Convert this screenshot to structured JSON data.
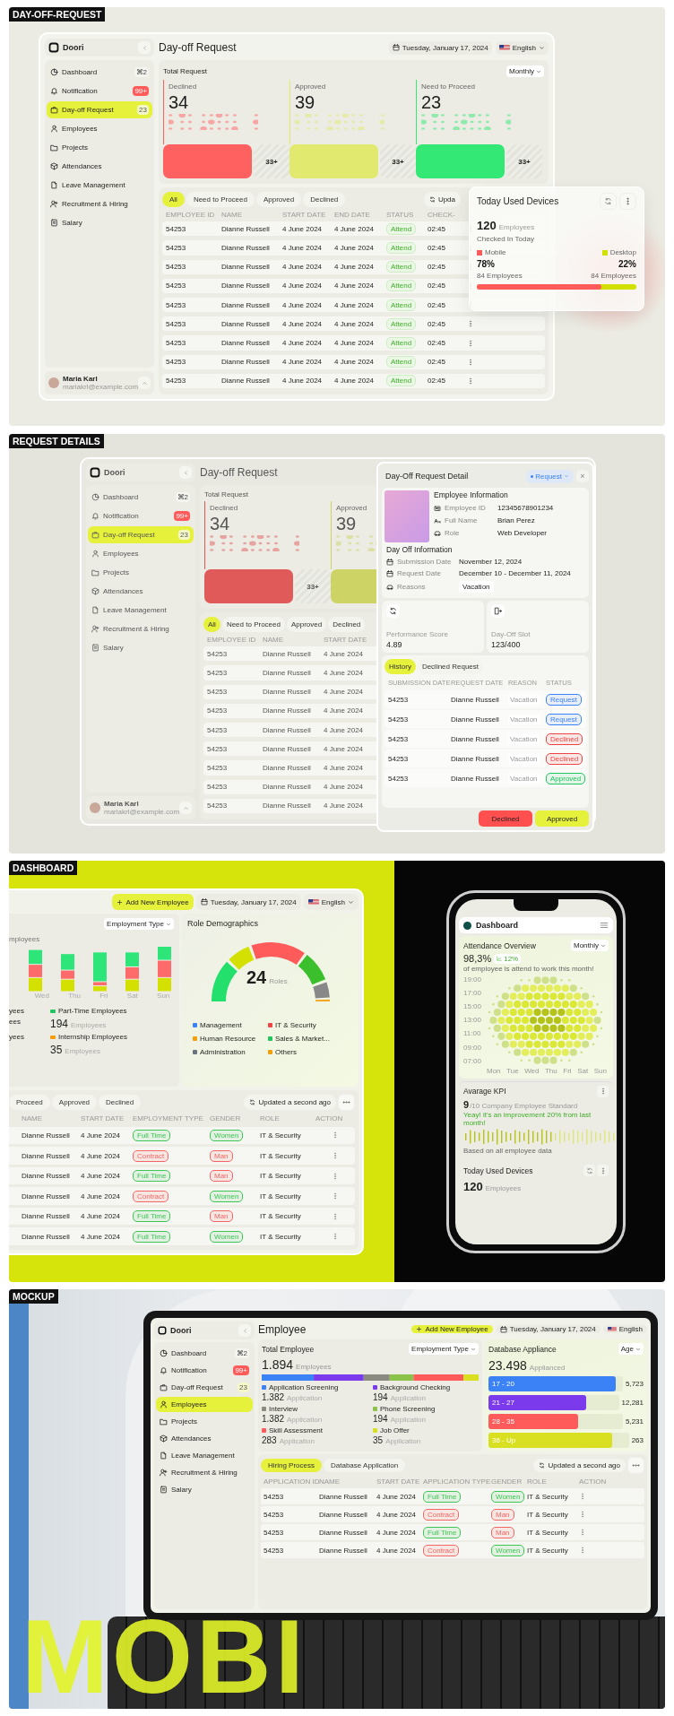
{
  "day_off_request": {
    "label": "DAY-OFF-REQUEST",
    "app": {
      "brand": "Doori",
      "nav": [
        {
          "label": "Dashboard",
          "kind": "dashboard",
          "badge": {
            "text": "⌘2",
            "kind": "shortcut"
          },
          "selected": false
        },
        {
          "label": "Notification",
          "kind": "notification",
          "badge": {
            "text": "99+",
            "kind": "alert"
          },
          "selected": false
        },
        {
          "label": "Day-off Request",
          "kind": "dayoff",
          "badge": {
            "text": "23",
            "kind": "count"
          },
          "selected": true
        },
        {
          "label": "Employees",
          "kind": "employees",
          "selected": false
        },
        {
          "label": "Projects",
          "kind": "projects",
          "selected": false
        },
        {
          "label": "Attendances",
          "kind": "attendances",
          "selected": false
        },
        {
          "label": "Leave Management",
          "kind": "leave",
          "selected": false
        },
        {
          "label": "Recruitment & Hiring",
          "kind": "recruitment",
          "selected": false
        },
        {
          "label": "Salary",
          "kind": "salary",
          "selected": false
        }
      ],
      "user": {
        "name": "Maria Karl",
        "email": "mariakrl@example.com"
      },
      "title": "Day-off Request",
      "date": "Tuesday, January 17, 2024",
      "language": "English",
      "stats": {
        "title": "Total Request",
        "period": "Monthly",
        "cards": [
          {
            "label": "Declined",
            "value": "34",
            "more": "33+",
            "color": "#ff6161"
          },
          {
            "label": "Approved",
            "value": "39",
            "more": "33+",
            "color": "#e2e96f"
          },
          {
            "label": "Need to Proceed",
            "value": "23",
            "more": "33+",
            "color": "#33e874"
          }
        ]
      },
      "filters": [
        {
          "label": "All",
          "selected": true
        },
        {
          "label": "Need to Proceed",
          "selected": false
        },
        {
          "label": "Approved",
          "selected": false
        },
        {
          "label": "Declined",
          "selected": false
        }
      ],
      "update": "Upda",
      "columns": [
        "EMPLOYEE ID",
        "NAME",
        "START DATE",
        "END DATE",
        "STATUS",
        "CHECK-"
      ],
      "rows": [
        {
          "cells": [
            "54253",
            "Dianne Russell",
            "4 June 2024",
            "4 June 2024"
          ],
          "status": "Attend",
          "time": "02:45"
        },
        {
          "cells": [
            "54253",
            "Dianne Russell",
            "4 June 2024",
            "4 June 2024"
          ],
          "status": "Attend",
          "time": "02:45"
        },
        {
          "cells": [
            "54253",
            "Dianne Russell",
            "4 June 2024",
            "4 June 2024"
          ],
          "status": "Attend",
          "time": "02:45"
        },
        {
          "cells": [
            "54253",
            "Dianne Russell",
            "4 June 2024",
            "4 June 2024"
          ],
          "status": "Attend",
          "time": "02:45"
        },
        {
          "cells": [
            "54253",
            "Dianne Russell",
            "4 June 2024",
            "4 June 2024"
          ],
          "status": "Attend",
          "time": "02:45"
        },
        {
          "cells": [
            "54253",
            "Dianne Russell",
            "4 June 2024",
            "4 June 2024"
          ],
          "status": "Attend",
          "time": "02:45"
        },
        {
          "cells": [
            "54253",
            "Dianne Russell",
            "4 June 2024",
            "4 June 2024"
          ],
          "status": "Attend",
          "time": "02:45"
        },
        {
          "cells": [
            "54253",
            "Dianne Russell",
            "4 June 2024",
            "4 June 2024"
          ],
          "status": "Attend",
          "time": "02:45"
        },
        {
          "cells": [
            "54253",
            "Dianne Russell",
            "4 June 2024",
            "4 June 2024"
          ],
          "status": "Attend",
          "time": "02:45"
        }
      ]
    },
    "devices_popup": {
      "title": "Today Used Devices",
      "count": "120",
      "unit": "Employees",
      "caption": "Checked In Today",
      "devices": [
        {
          "name": "Mobile",
          "color": "#ff5b5b",
          "percent": "78%",
          "employees": "84 Employees",
          "level": 0.78
        },
        {
          "name": "Desktop",
          "color": "#d2e000",
          "percent": "22%",
          "employees": "84 Employees"
        }
      ]
    }
  },
  "request_details": {
    "label": "REQUEST DETAILS",
    "background_app": {
      "brand": "Doori",
      "nav": [
        {
          "label": "Dashboard",
          "kind": "dashboard",
          "badge": {
            "text": "⌘2",
            "kind": "shortcut"
          },
          "selected": false
        },
        {
          "label": "Notification",
          "kind": "notification",
          "badge": {
            "text": "99+",
            "kind": "alert"
          },
          "selected": false
        },
        {
          "label": "Day-off Request",
          "kind": "dayoff",
          "badge": {
            "text": "23",
            "kind": "count"
          },
          "selected": true
        },
        {
          "label": "Employees",
          "kind": "employees",
          "selected": false
        },
        {
          "label": "Projects",
          "kind": "projects",
          "selected": false
        },
        {
          "label": "Attendances",
          "kind": "attendances",
          "selected": false
        },
        {
          "label": "Leave Management",
          "kind": "leave",
          "selected": false
        },
        {
          "label": "Recruitment & Hiring",
          "kind": "recruitment",
          "selected": false
        },
        {
          "label": "Salary",
          "kind": "salary",
          "selected": false
        }
      ],
      "user": {
        "name": "Maria Karl",
        "email": "mariakrl@example.com"
      },
      "title": "Day-off Request",
      "stats": {
        "title": "Total Request",
        "cards": [
          {
            "label": "Declined",
            "value": "34",
            "more": "33+",
            "color": "#e05a5a"
          },
          {
            "label": "Approved",
            "value": "39",
            "color": "#cdd465"
          }
        ]
      },
      "filters": [
        {
          "label": "All",
          "selected": true
        },
        {
          "label": "Need to Proceed",
          "selected": false
        },
        {
          "label": "Approved",
          "selected": false
        },
        {
          "label": "Declined",
          "selected": false
        }
      ],
      "columns": [
        "EMPLOYEE ID",
        "NAME",
        "START DATE"
      ],
      "rows": [
        {
          "cells": [
            "54253",
            "Dianne Russell",
            "4 June 2024"
          ]
        },
        {
          "cells": [
            "54253",
            "Dianne Russell",
            "4 June 2024"
          ]
        },
        {
          "cells": [
            "54253",
            "Dianne Russell",
            "4 June 2024"
          ]
        },
        {
          "cells": [
            "54253",
            "Dianne Russell",
            "4 June 2024"
          ]
        },
        {
          "cells": [
            "54253",
            "Dianne Russell",
            "4 June 2024"
          ]
        },
        {
          "cells": [
            "54253",
            "Dianne Russell",
            "4 June 2024"
          ]
        },
        {
          "cells": [
            "54253",
            "Dianne Russell",
            "4 June 2024"
          ]
        },
        {
          "cells": [
            "54253",
            "Dianne Russell",
            "4 June 2024"
          ]
        },
        {
          "cells": [
            "54253",
            "Dianne Russell",
            "4 June 2024"
          ]
        }
      ]
    },
    "detail_panel": {
      "title": "Day-Off Request Detail",
      "status_chip": "Request",
      "close": "×",
      "employee": {
        "heading": "Employee Information",
        "fields": [
          {
            "kind": "id",
            "label": "Employee ID",
            "value": "12345678901234"
          },
          {
            "kind": "name",
            "label": "Full Name",
            "value": "Brian Perez"
          },
          {
            "kind": "role",
            "label": "Role",
            "value": "Web Developer"
          }
        ]
      },
      "day_off": {
        "heading": "Day Off Information",
        "fields": [
          {
            "kind": "date",
            "label": "Submission Date",
            "value": "November 12, 2024"
          },
          {
            "kind": "date",
            "label": "Request Date",
            "value": "December 10 - December 11, 2024"
          },
          {
            "kind": "reason",
            "label": "Reasons",
            "value": "Vacation"
          }
        ]
      },
      "metrics": [
        {
          "kind": "refresh",
          "label": "Performance Score",
          "value": "4.89"
        },
        {
          "kind": "exit",
          "label": "Day-Off Slot",
          "value": "123/400"
        }
      ],
      "tabs": [
        {
          "label": "History",
          "selected": true
        },
        {
          "label": "Declined Request",
          "selected": false
        }
      ],
      "columns": [
        "SUBMISSION DATE",
        "REQUEST DATE",
        "REASON",
        "STATUS"
      ],
      "rows": [
        {
          "submission": "54253",
          "request": "Dianne Russell",
          "reason": "Vacation",
          "status": "Request",
          "color": "#3b82f6"
        },
        {
          "submission": "54253",
          "request": "Dianne Russell",
          "reason": "Vacation",
          "status": "Request",
          "color": "#3b82f6"
        },
        {
          "submission": "54253",
          "request": "Dianne Russell",
          "reason": "Vacation",
          "status": "Declined",
          "color": "#ef4444"
        },
        {
          "submission": "54253",
          "request": "Dianne Russell",
          "reason": "Vacation",
          "status": "Declined",
          "color": "#ef4444"
        },
        {
          "submission": "54253",
          "request": "Dianne Russell",
          "reason": "Vacation",
          "status": "Approved",
          "color": "#22c55e"
        }
      ],
      "buttons": [
        {
          "label": "Declined",
          "kind": "reject"
        },
        {
          "label": "Approved",
          "kind": "approve"
        }
      ]
    }
  },
  "dashboard": {
    "label": "DASHBOARD",
    "desktop": {
      "add_button": "Add New Employee",
      "date": "Tuesday, January 17, 2024",
      "language": "English",
      "employment": {
        "filter": "Employment Type",
        "caption": "mployees",
        "days": [
          "Wed",
          "Thu",
          "Fri",
          "Sat",
          "Sun"
        ],
        "left_fragments": [
          "yees",
          "ees",
          "yees"
        ],
        "groups": [
          {
            "label": "Part-Time Employees",
            "color": "#22c55e",
            "value": "194",
            "unit": "Employees"
          },
          {
            "label": "Internship Employees",
            "color": "#f59e0b",
            "value": "35",
            "unit": "Employees"
          }
        ]
      },
      "roles": {
        "title": "Role Demographics",
        "value": "24",
        "unit": "Roles",
        "legend": [
          {
            "label": "Management",
            "color": "#3b82f6"
          },
          {
            "label": "IT & Security",
            "color": "#ef4444"
          },
          {
            "label": "Human Resource",
            "color": "#f59e0b"
          },
          {
            "label": "Sales & Market...",
            "color": "#22c55e"
          },
          {
            "label": "Administration",
            "color": "#6b7280"
          },
          {
            "label": "Others",
            "color": "#f59e0b"
          }
        ]
      },
      "filters": [
        {
          "label": "Proceed",
          "selected": false
        },
        {
          "label": "Approved",
          "selected": false
        },
        {
          "label": "Declined",
          "selected": false
        }
      ],
      "update": "Updated a second ago",
      "columns": [
        "NAME",
        "START DATE",
        "EMPLOYMENT TYPE",
        "GENDER",
        "ROLE",
        "ACTION"
      ],
      "rows": [
        {
          "name": "Dianne Russell",
          "start": "4 June 2024",
          "type": {
            "text": "Full Time",
            "color": "#3fc556"
          },
          "gender": {
            "text": "Women",
            "color": "#3fc556"
          },
          "role": "IT & Security"
        },
        {
          "name": "Dianne Russell",
          "start": "4 June 2024",
          "type": {
            "text": "Contract",
            "color": "#f26666"
          },
          "gender": {
            "text": "Man",
            "color": "#f26666"
          },
          "role": "IT & Security"
        },
        {
          "name": "Dianne Russell",
          "start": "4 June 2024",
          "type": {
            "text": "Full Time",
            "color": "#3fc556"
          },
          "gender": {
            "text": "Man",
            "color": "#f26666"
          },
          "role": "IT & Security"
        },
        {
          "name": "Dianne Russell",
          "start": "4 June 2024",
          "type": {
            "text": "Contract",
            "color": "#f26666"
          },
          "gender": {
            "text": "Women",
            "color": "#3fc556"
          },
          "role": "IT & Security"
        },
        {
          "name": "Dianne Russell",
          "start": "4 June 2024",
          "type": {
            "text": "Full Time",
            "color": "#3fc556"
          },
          "gender": {
            "text": "Man",
            "color": "#f26666"
          },
          "role": "IT & Security"
        },
        {
          "name": "Dianne Russell",
          "start": "4 June 2024",
          "type": {
            "text": "Full Time",
            "color": "#3fc556"
          },
          "gender": {
            "text": "Women",
            "color": "#3fc556"
          },
          "role": "IT & Security"
        }
      ]
    },
    "phone": {
      "title": "Dashboard",
      "attendance": {
        "title": "Attendance Overview",
        "period": "Monthly",
        "value": "98,3%",
        "change": "12%",
        "caption": "of employee is attend to work this month!",
        "hours": [
          "19:00",
          "17:00",
          "15:00",
          "13:00",
          "11:00",
          "09:00",
          "07:00"
        ],
        "days": [
          "Mon",
          "Tue",
          "Wed",
          "Thu",
          "Fri",
          "Sat",
          "Sun"
        ]
      },
      "kpi": {
        "title": "Avarage KPI",
        "score": "9",
        "scale": "/10 Company Employee Standard",
        "note": "Yeay! it's an improvement 20% from last month!",
        "footer": "Based on all employee data"
      },
      "devices": {
        "title": "Today Used Devices",
        "count": "120",
        "unit": "Employees"
      }
    }
  },
  "mockup": {
    "label": "MOCKUP",
    "headline": "MOBI",
    "laptop": {
      "brand": "Doori",
      "nav": [
        {
          "label": "Dashboard",
          "kind": "dashboard",
          "badge": {
            "text": "⌘2",
            "kind": "shortcut"
          },
          "selected": false
        },
        {
          "label": "Notification",
          "kind": "notification",
          "badge": {
            "text": "99+",
            "kind": "alert"
          },
          "selected": false
        },
        {
          "label": "Day-off Request",
          "kind": "dayoff",
          "badge": {
            "text": "23",
            "kind": "count"
          },
          "selected": false
        },
        {
          "label": "Employees",
          "kind": "employees",
          "selected": true
        },
        {
          "label": "Projects",
          "kind": "projects",
          "selected": false
        },
        {
          "label": "Attendances",
          "kind": "attendances",
          "selected": false
        },
        {
          "label": "Leave Management",
          "kind": "leave",
          "selected": false
        },
        {
          "label": "Recruitment & Hiring",
          "kind": "recruitment",
          "selected": false
        },
        {
          "label": "Salary",
          "kind": "salary",
          "selected": false
        }
      ],
      "title": "Employee",
      "add_button": "Add New Employee",
      "date": "Tuesday, January 17, 2024",
      "language": "English",
      "total": {
        "title": "Total Employee",
        "value": "1.894",
        "unit": "Employees",
        "filter": "Employment Type",
        "stages": [
          {
            "label": "Application Screening",
            "value": "1.382",
            "unit": "Application",
            "color": "#3b82f6"
          },
          {
            "label": "Background Checking",
            "value": "194",
            "unit": "Application",
            "color": "#7c3aed"
          },
          {
            "label": "Interview",
            "value": "1.382",
            "unit": "Application",
            "color": "#8a8a80"
          },
          {
            "label": "Phone Screening",
            "value": "194",
            "unit": "Application",
            "color": "#8bc34a"
          },
          {
            "label": "Skill Assessment",
            "value": "283",
            "unit": "Application",
            "color": "#ff5b5b"
          },
          {
            "label": "Job Offer",
            "value": "35",
            "unit": "Application",
            "color": "#d9e021"
          }
        ]
      },
      "database": {
        "title": "Database Appliance",
        "value": "23.498",
        "unit": "Applianced",
        "filter": "Age",
        "bars": [
          {
            "label": "17 - 20",
            "value": "5,723",
            "color": "#3b82f6",
            "level": 0.95
          },
          {
            "label": "21 - 27",
            "value": "12,281",
            "color": "#7c3aed",
            "level": 0.75
          },
          {
            "label": "28 - 35",
            "value": "5,231",
            "color": "#ff5b5b",
            "level": 0.67
          },
          {
            "label": "36 - Up",
            "value": "263",
            "color": "#d9e021",
            "level": 0.88
          }
        ]
      },
      "tabs": [
        {
          "label": "Hiring Process",
          "selected": true
        },
        {
          "label": "Database Application",
          "selected": false
        }
      ],
      "update": "Updated a second ago",
      "columns": [
        "APPLICATION ID",
        "NAME",
        "START DATE",
        "APPLICATION TYPE",
        "GENDER",
        "ROLE",
        "ACTION"
      ],
      "rows": [
        {
          "id": "54253",
          "name": "Dianne Russell",
          "start": "4 June 2024",
          "type": {
            "text": "Full Time",
            "color": "#3fc556"
          },
          "gender": {
            "text": "Women",
            "color": "#3fc556"
          },
          "role": "IT & Security"
        },
        {
          "id": "54253",
          "name": "Dianne Russell",
          "start": "4 June 2024",
          "type": {
            "text": "Contract",
            "color": "#f26666"
          },
          "gender": {
            "text": "Man",
            "color": "#f26666"
          },
          "role": "IT & Security"
        },
        {
          "id": "54253",
          "name": "Dianne Russell",
          "start": "4 June 2024",
          "type": {
            "text": "Full Time",
            "color": "#3fc556"
          },
          "gender": {
            "text": "Man",
            "color": "#f26666"
          },
          "role": "IT & Security"
        },
        {
          "id": "54253",
          "name": "Dianne Russell",
          "start": "4 June 2024",
          "type": {
            "text": "Contract",
            "color": "#f26666"
          },
          "gender": {
            "text": "Women",
            "color": "#3fc556"
          },
          "role": "IT & Security"
        }
      ]
    }
  }
}
